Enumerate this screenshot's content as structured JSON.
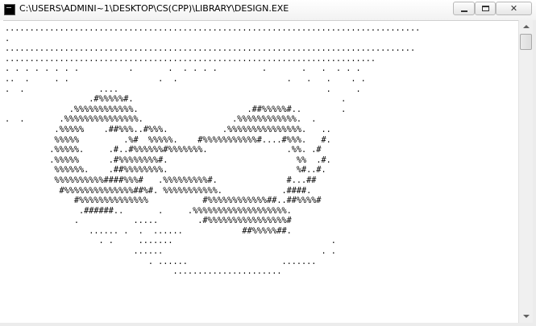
{
  "window": {
    "title": "C:\\USERS\\ADMINI~1\\DESKTOP\\CS(CPP)\\LIBRARY\\DESIGN.EXE",
    "icon": "console-app-icon",
    "controls": {
      "minimize_icon": "minimize-icon",
      "maximize_icon": "maximize-icon",
      "close_label": "✕"
    }
  },
  "console": {
    "text": "....................................................................................\n.\n...................................................................................\n...........................................................................\n. . . . . . . .          .       .  . . . .         .       .   .  . . .\n..  .     . .                  .  .                      .   .   .    . .\n.  .               ....                                          .     .\n                 .#%%%%%#.                                          .\n             .%%%%%%%%%%%%.                      .##%%%%%#..        .\n.  .       .%%%%%%%%%%%%%%%.                  .%%%%%%%%%%%%.  .\n          .%%%%%    .##%%%..#%%%.           .%%%%%%%%%%%%%%%.   ..\n          %%%%%         .%#  %%%%%.    #%%%%%%%%%%%#....#%%%.   #.\n         .%%%%%.     .#..#%%%%%%#%%%%%%%.                .%%. .#\n         .%%%%%      .#%%%%%%%%#.                          %%  .#.\n          %%%%%%.    .##%%%%%%%%.                          %#..#.\n          %%%%%%%%%%####%%%#   .%%%%%%%%%#.              #...##\n           #%%%%%%%%%%%%%%##%#. %%%%%%%%%%%.            .####.\n              #%%%%%%%%%%%%%%           #%%%%%%%%%%%%##..##%%%%#\n               .######..       .     .%%%%%%%%%%%%%%%%%%%.\n              .           .....        .#%%%%%%%%%%%%%%%%#\n                 ...... .  .  ......            ##%%%%%##.\n                   . .     .......                                .\n                          ......                                . .\n                             . ......                   .......\n                                  ......................"
  }
}
